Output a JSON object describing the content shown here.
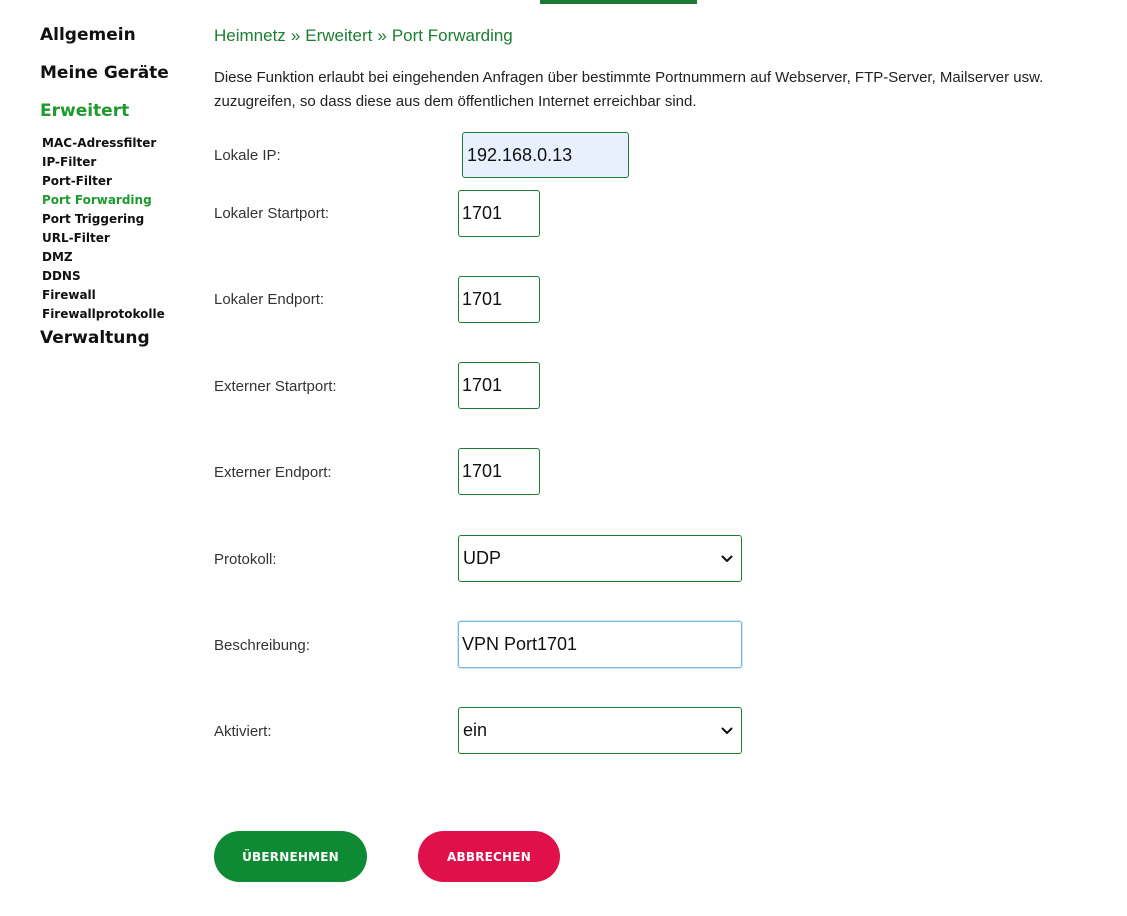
{
  "sidebar": {
    "main_items": {
      "allgemein": "Allgemein",
      "geraete": "Meine Geräte",
      "erweitert": "Erweitert",
      "verwaltung": "Verwaltung"
    },
    "sub_items": [
      "MAC-Adressfilter",
      "IP-Filter",
      "Port-Filter",
      "Port Forwarding",
      "Port Triggering",
      "URL-Filter",
      "DMZ",
      "DDNS",
      "Firewall",
      "Firewallprotokolle"
    ],
    "active_sub_item": "Port Forwarding"
  },
  "breadcrumb": {
    "part1": "Heimnetz",
    "separator": "»",
    "part2": "Erweitert",
    "part3": "Port Forwarding"
  },
  "description": "Diese Funktion erlaubt bei eingehenden Anfragen über bestimmte Portnummern auf Webserver, FTP-Server, Mailserver usw. zuzugreifen, so dass diese aus dem öffentlichen Internet erreichbar sind.",
  "form": {
    "local_ip": {
      "label": "Lokale IP:",
      "value": "192.168.0.13"
    },
    "local_start_port": {
      "label": "Lokaler Startport:",
      "value": "1701"
    },
    "local_end_port": {
      "label": "Lokaler Endport:",
      "value": "1701"
    },
    "external_start_port": {
      "label": "Externer Startport:",
      "value": "1701"
    },
    "external_end_port": {
      "label": "Externer Endport:",
      "value": "1701"
    },
    "protocol": {
      "label": "Protokoll:",
      "value": "UDP"
    },
    "description": {
      "label": "Beschreibung:",
      "value": "VPN Port1701"
    },
    "enabled": {
      "label": "Aktiviert:",
      "value": "ein"
    }
  },
  "buttons": {
    "apply": "ÜBERNEHMEN",
    "cancel": "ABBRECHEN"
  },
  "colors": {
    "brand_green": "#1e7d34",
    "active_green": "#1e9a2e",
    "apply_button": "#0f8a34",
    "cancel_button": "#e0104a",
    "autofill_bg": "#e8f0fe"
  },
  "icons": {
    "select_arrow": "chevron-down-icon"
  }
}
